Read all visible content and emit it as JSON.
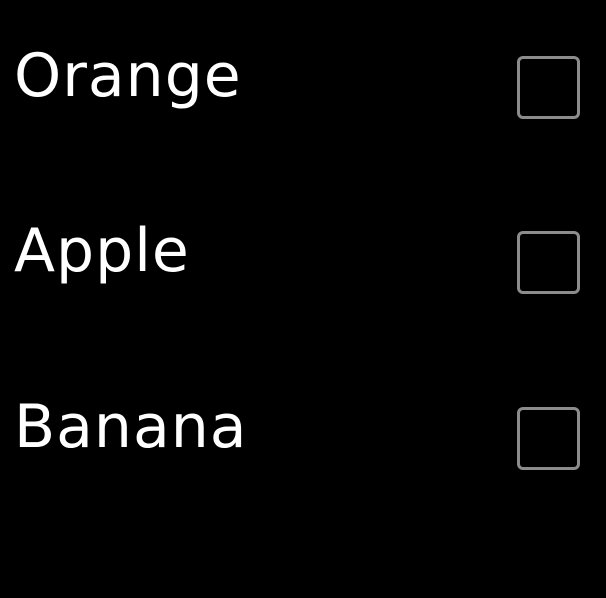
{
  "list": {
    "items": [
      {
        "label": "Orange",
        "checked": false
      },
      {
        "label": "Apple",
        "checked": false
      },
      {
        "label": "Banana",
        "checked": false
      }
    ]
  },
  "colors": {
    "background": "#000000",
    "text": "#ffffff",
    "checkbox_border": "#8c8c8c"
  }
}
